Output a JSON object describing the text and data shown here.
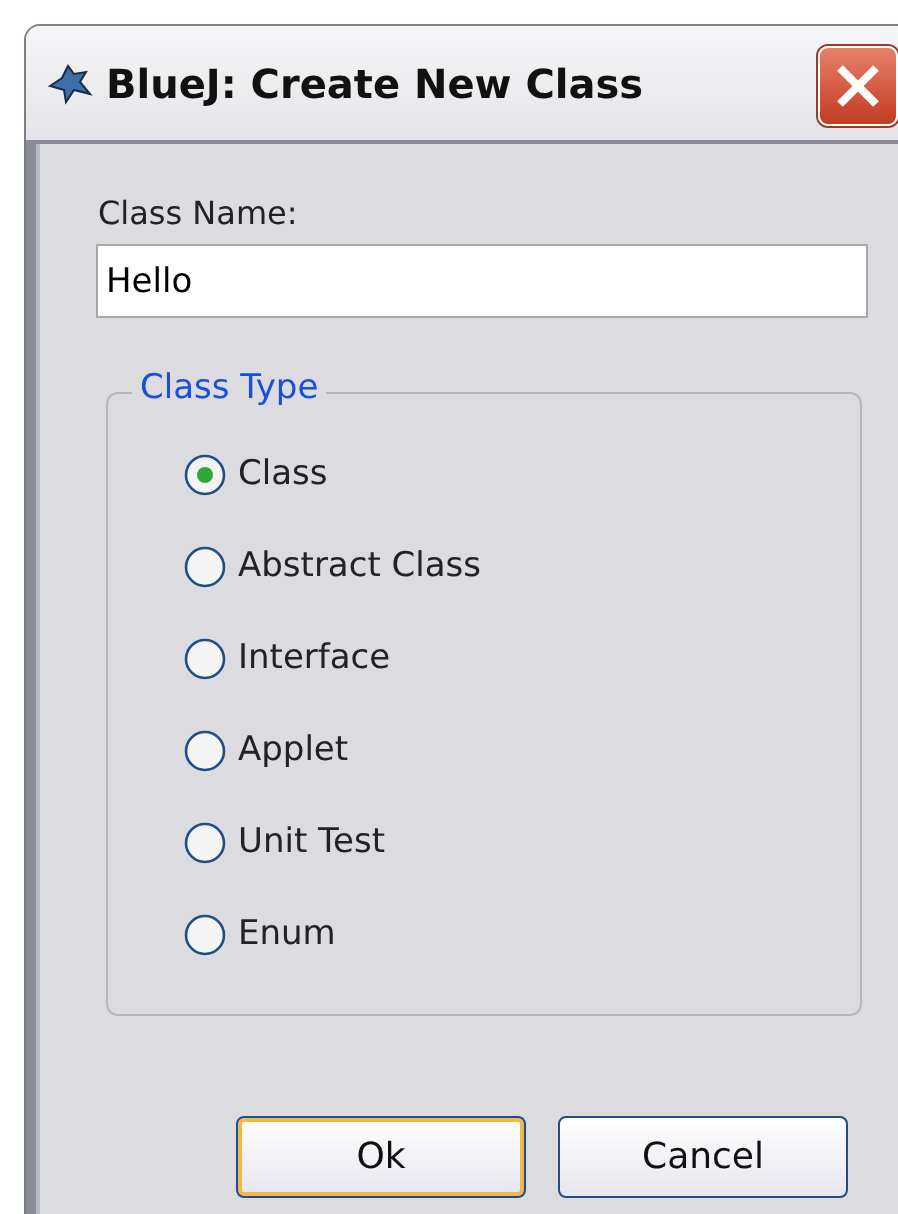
{
  "window": {
    "title": "BlueJ:  Create New Class"
  },
  "class_name": {
    "label": "Class Name:",
    "value": "Hello"
  },
  "class_type": {
    "legend": "Class Type",
    "options": [
      {
        "label": "Class",
        "selected": true
      },
      {
        "label": "Abstract Class",
        "selected": false
      },
      {
        "label": "Interface",
        "selected": false
      },
      {
        "label": "Applet",
        "selected": false
      },
      {
        "label": "Unit Test",
        "selected": false
      },
      {
        "label": "Enum",
        "selected": false
      }
    ]
  },
  "buttons": [
    {
      "label": "Ok",
      "default": true
    },
    {
      "label": "Cancel",
      "default": false
    }
  ]
}
